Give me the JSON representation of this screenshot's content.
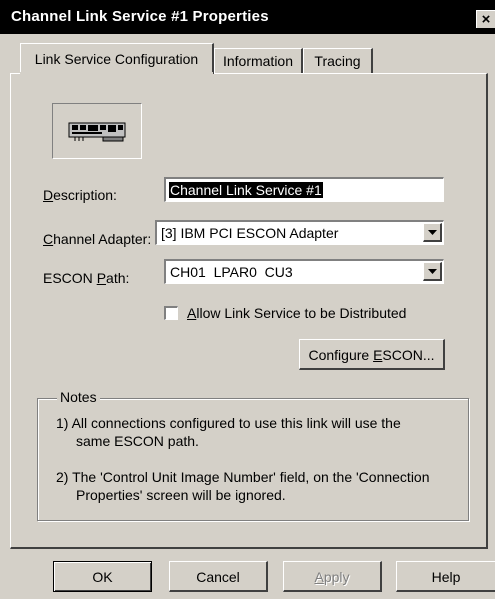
{
  "window": {
    "title": "Channel Link Service #1 Properties",
    "close_glyph": "×"
  },
  "tabs": [
    {
      "label": "Link Service Configuration",
      "active": true
    },
    {
      "label": "Information",
      "active": false
    },
    {
      "label": "Tracing",
      "active": false
    }
  ],
  "icon": {
    "name": "adapter-card-icon"
  },
  "form": {
    "description": {
      "label_ul": "D",
      "label_rest": "escription:",
      "value": "Channel Link Service #1"
    },
    "channel_adapter": {
      "label_ul": "C",
      "label_rest": "hannel Adapter:",
      "value": "[3] IBM PCI ESCON Adapter"
    },
    "escon_path": {
      "label_pre": "ESCON ",
      "label_ul": "P",
      "label_rest": "ath:",
      "value": "CH01  LPAR0  CU3"
    },
    "distribute": {
      "label_ul": "A",
      "label_rest": "llow Link Service to be Distributed",
      "checked": false
    }
  },
  "configure_button": {
    "label_pre": "Configure ",
    "label_ul": "E",
    "label_rest": "SCON..."
  },
  "notes": {
    "title": "Notes",
    "note1_line1": "1) All connections configured to use this link will use the",
    "note1_line2": "same ESCON path.",
    "note2_line1": "2) The 'Control Unit Image Number' field, on the 'Connection",
    "note2_line2": "Properties' screen will be ignored."
  },
  "buttons": {
    "ok": "OK",
    "cancel": "Cancel",
    "apply_ul": "A",
    "apply_rest": "pply",
    "help": "Help"
  }
}
